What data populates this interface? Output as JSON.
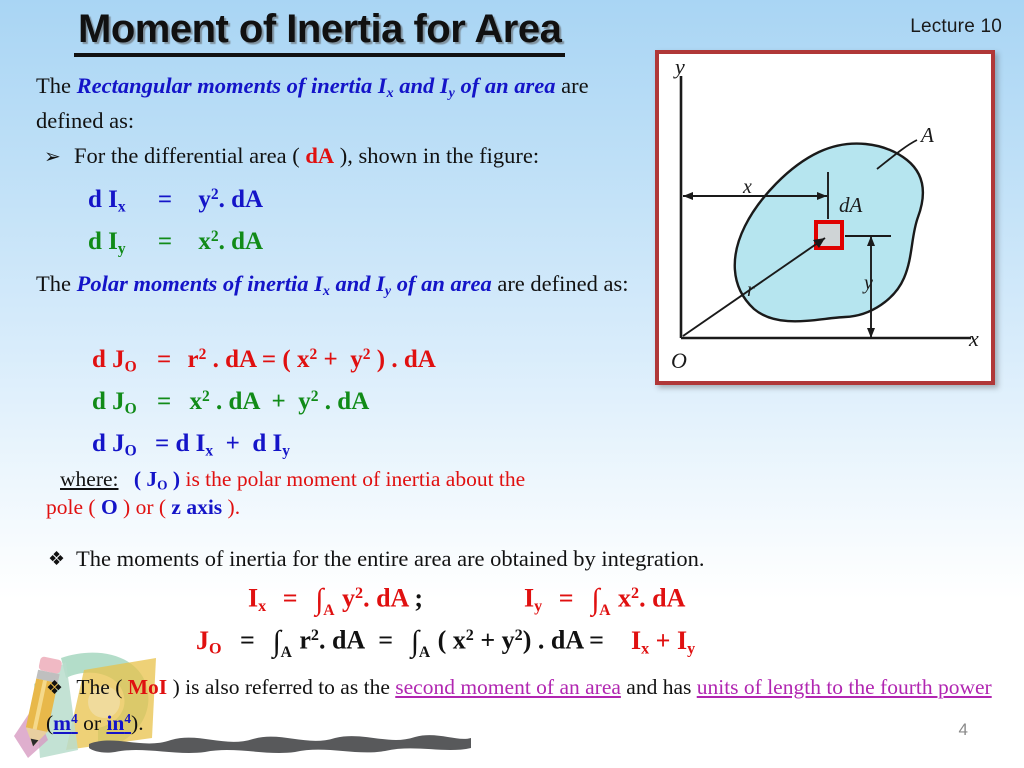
{
  "header": {
    "lecture_label": "Lecture 10",
    "title": "Moment of Inertia for Area"
  },
  "intro": {
    "lead": "The ",
    "emphasis": "Rectangular moments of inertia Iₓ and Iᵧ of an area",
    "emphasis_part1": "Rectangular moments of inertia I",
    "emphasis_sub1": "x",
    "emphasis_part2": " and I",
    "emphasis_sub2": "y",
    "emphasis_part3": " of an area",
    "tail": " are defined as:",
    "bullet_glyph": "➢",
    "bullet_text_a": "For the differential area ( ",
    "bullet_dA": "dA",
    "bullet_text_b": " ), shown in the figure:"
  },
  "equations_rect": [
    {
      "name": "dIx",
      "lhs": "d I",
      "lhs_sub": "x",
      "eq": "=",
      "rhs_base": "y",
      "rhs_sup": "2",
      "rhs_tail": ". dA",
      "color": "#1414c8"
    },
    {
      "name": "dIy",
      "lhs": "d I",
      "lhs_sub": "y",
      "eq": "=",
      "rhs_base": "x",
      "rhs_sup": "2",
      "rhs_tail": ". dA",
      "color": "#118b18"
    }
  ],
  "polar_intro": {
    "lead": "The ",
    "emphasis_part1": "Polar moments of inertia I",
    "emphasis_sub1": "x",
    "emphasis_part2": " and I",
    "emphasis_sub2": "y",
    "emphasis_part3": " of an area",
    "tail": " are defined as:"
  },
  "equations_polar": [
    {
      "name": "dJo-1",
      "text": "d Jₒ  =   r² . dA = ( x² +  y² ) . dA",
      "color": "#e01010"
    },
    {
      "name": "dJo-2",
      "text": "d Jₒ  =   x² . dA  +  y² . dA",
      "color": "#118b18"
    },
    {
      "name": "dJo-3",
      "text": "d Jₒ  = d Iₓ  +  d Iᵧ",
      "color": "#1414c8"
    }
  ],
  "where_block": {
    "keyword": "where:",
    "symbol": "( J",
    "symbol_sub": "O",
    "symbol_close": " )",
    "text1": " is the polar moment of inertia about the",
    "line2_a": "pole ( ",
    "line2_O": "O",
    "line2_b": " ) or ( ",
    "line2_z": "z axis",
    "line2_c": " )."
  },
  "integration": {
    "bullet_glyph": "❖",
    "bullet_text": "The moments of inertia for the entire area are obtained by integration.",
    "eq_Ix_lhs": "I",
    "eq_Ix_sub": "x",
    "eq_Ix_rest": "=",
    "eq_Ix_int_sub": "A",
    "eq_Ix_base": "y",
    "eq_Ix_sup": "2",
    "eq_Ix_tail": ". dA",
    "semicolon": ";",
    "eq_Iy_lhs": "I",
    "eq_Iy_sub": "y",
    "eq_Iy_rest": "=",
    "eq_Iy_int_sub": "A",
    "eq_Iy_base": "x",
    "eq_Iy_sup": "2",
    "eq_Iy_tail": ".  dA",
    "eq_Jo_lhs": "J",
    "eq_Jo_sub": "O",
    "eq_Jo_eq1": "=",
    "eq_Jo_int1_sub": "A",
    "eq_Jo_r": "r",
    "eq_Jo_r_sup": "2",
    "eq_Jo_dA1": ". dA",
    "eq_Jo_eq2": "=",
    "eq_Jo_int2_sub": "A",
    "eq_Jo_paren_open": "( x",
    "eq_Jo_x_sup": "2",
    "eq_Jo_plus": " + y",
    "eq_Jo_y_sup": "2",
    "eq_Jo_paren_close": ") .  dA =",
    "eq_Jo_result_Ix": "I",
    "eq_Jo_result_Ix_sub": "x",
    "eq_Jo_result_plus": "  +  I",
    "eq_Jo_result_Iy_sub": "y"
  },
  "footnote": {
    "bullet_glyph": "❖",
    "a": "The ( ",
    "moi": "MoI",
    "b": " ) is also referred to as the ",
    "link1": "second moment of an area",
    "c": " and has ",
    "link2": "units of length to the fourth power",
    "d": " (",
    "unit1_base": "m",
    "unit1_sup": "4",
    "or": " or ",
    "unit2_base": "in",
    "unit2_sup": "4",
    "e": ")."
  },
  "figure": {
    "name": "moment-of-inertia-area-diagram",
    "labels": {
      "y_axis": "y",
      "x_axis": "x",
      "origin": "O",
      "area": "A",
      "dA": "dA",
      "x_dim": "x",
      "y_dim": "y",
      "r": "r"
    },
    "area_fill": "#b6e5ef",
    "highlight_color": "#e00000"
  },
  "page_number": "4",
  "colors": {
    "blue": "#1414c8",
    "green": "#118b18",
    "red": "#e01010",
    "magenta": "#b126b1",
    "border_red": "#b03838",
    "bg_top": "#a9d5f4"
  }
}
